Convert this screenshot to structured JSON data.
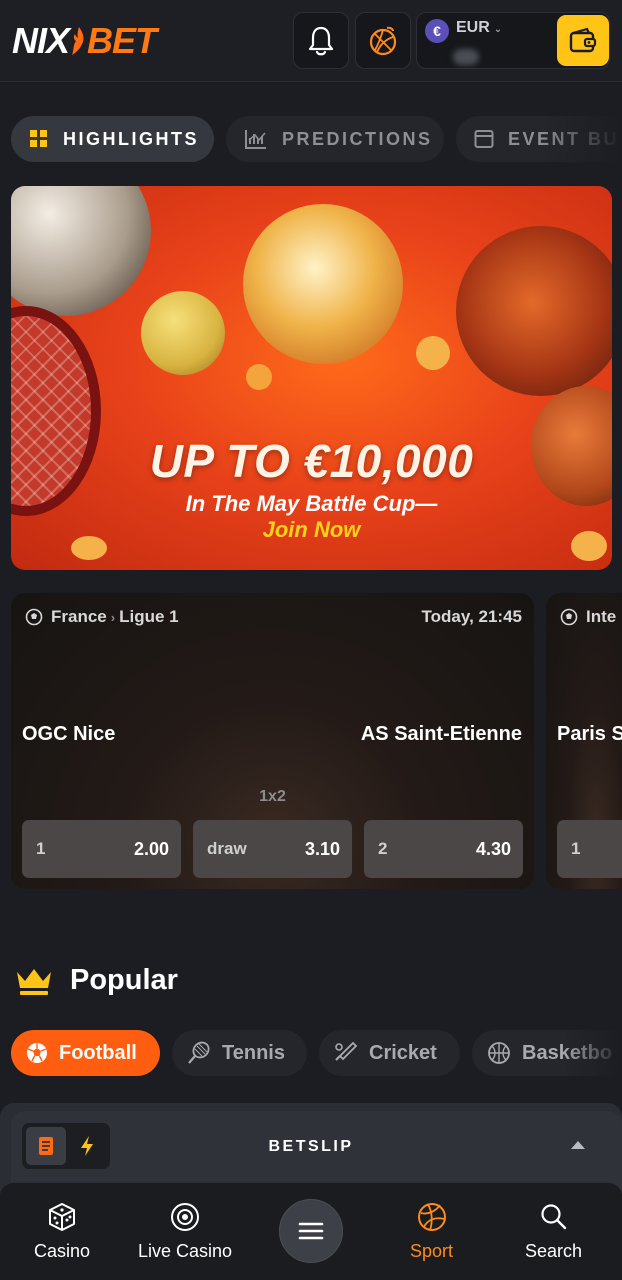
{
  "header": {
    "logo_left": "NIX",
    "logo_right": "BET",
    "currency_symbol": "€",
    "currency": "EUR",
    "icons": [
      "bell-icon",
      "orange-ball-icon",
      "wallet-icon"
    ]
  },
  "tabs": [
    {
      "label": "HIGHLIGHTS",
      "icon": "grid-icon",
      "active": true
    },
    {
      "label": "PREDICTIONS",
      "icon": "chart-icon",
      "active": false
    },
    {
      "label": "EVENT BU",
      "icon": "calendar-icon",
      "active": false
    }
  ],
  "banner": {
    "title": "UP TO €10,000",
    "subtitle": "In The May Battle Cup—",
    "cta": "Join Now"
  },
  "events": [
    {
      "country": "France",
      "league": "Ligue 1",
      "time": "Today, 21:45",
      "home": "OGC Nice",
      "away": "AS Saint-Etienne",
      "market": "1x2",
      "odds": [
        {
          "label": "1",
          "value": "2.00"
        },
        {
          "label": "draw",
          "value": "3.10"
        },
        {
          "label": "2",
          "value": "4.30"
        }
      ]
    },
    {
      "league_partial": "Inte",
      "home_partial": "Paris S",
      "odd_partial": "1"
    }
  ],
  "popular": {
    "title": "Popular",
    "sports": [
      {
        "label": "Football",
        "icon": "football-icon",
        "active": true
      },
      {
        "label": "Tennis",
        "icon": "tennis-icon",
        "active": false
      },
      {
        "label": "Cricket",
        "icon": "cricket-icon",
        "active": false
      },
      {
        "label": "Basketbo",
        "icon": "basketball-icon",
        "active": false
      }
    ]
  },
  "betslip": {
    "title": "BETSLIP"
  },
  "bottom_nav": [
    {
      "label": "Casino",
      "icon": "dice-icon",
      "active": false
    },
    {
      "label": "Live Casino",
      "icon": "chip-icon",
      "active": false
    },
    {
      "label": "Sport",
      "icon": "sport-ball-icon",
      "active": true
    },
    {
      "label": "Search",
      "icon": "search-icon",
      "active": false
    }
  ],
  "colors": {
    "accent": "#ff5e10",
    "wallet": "#ffc416",
    "background": "#1b1d22"
  }
}
